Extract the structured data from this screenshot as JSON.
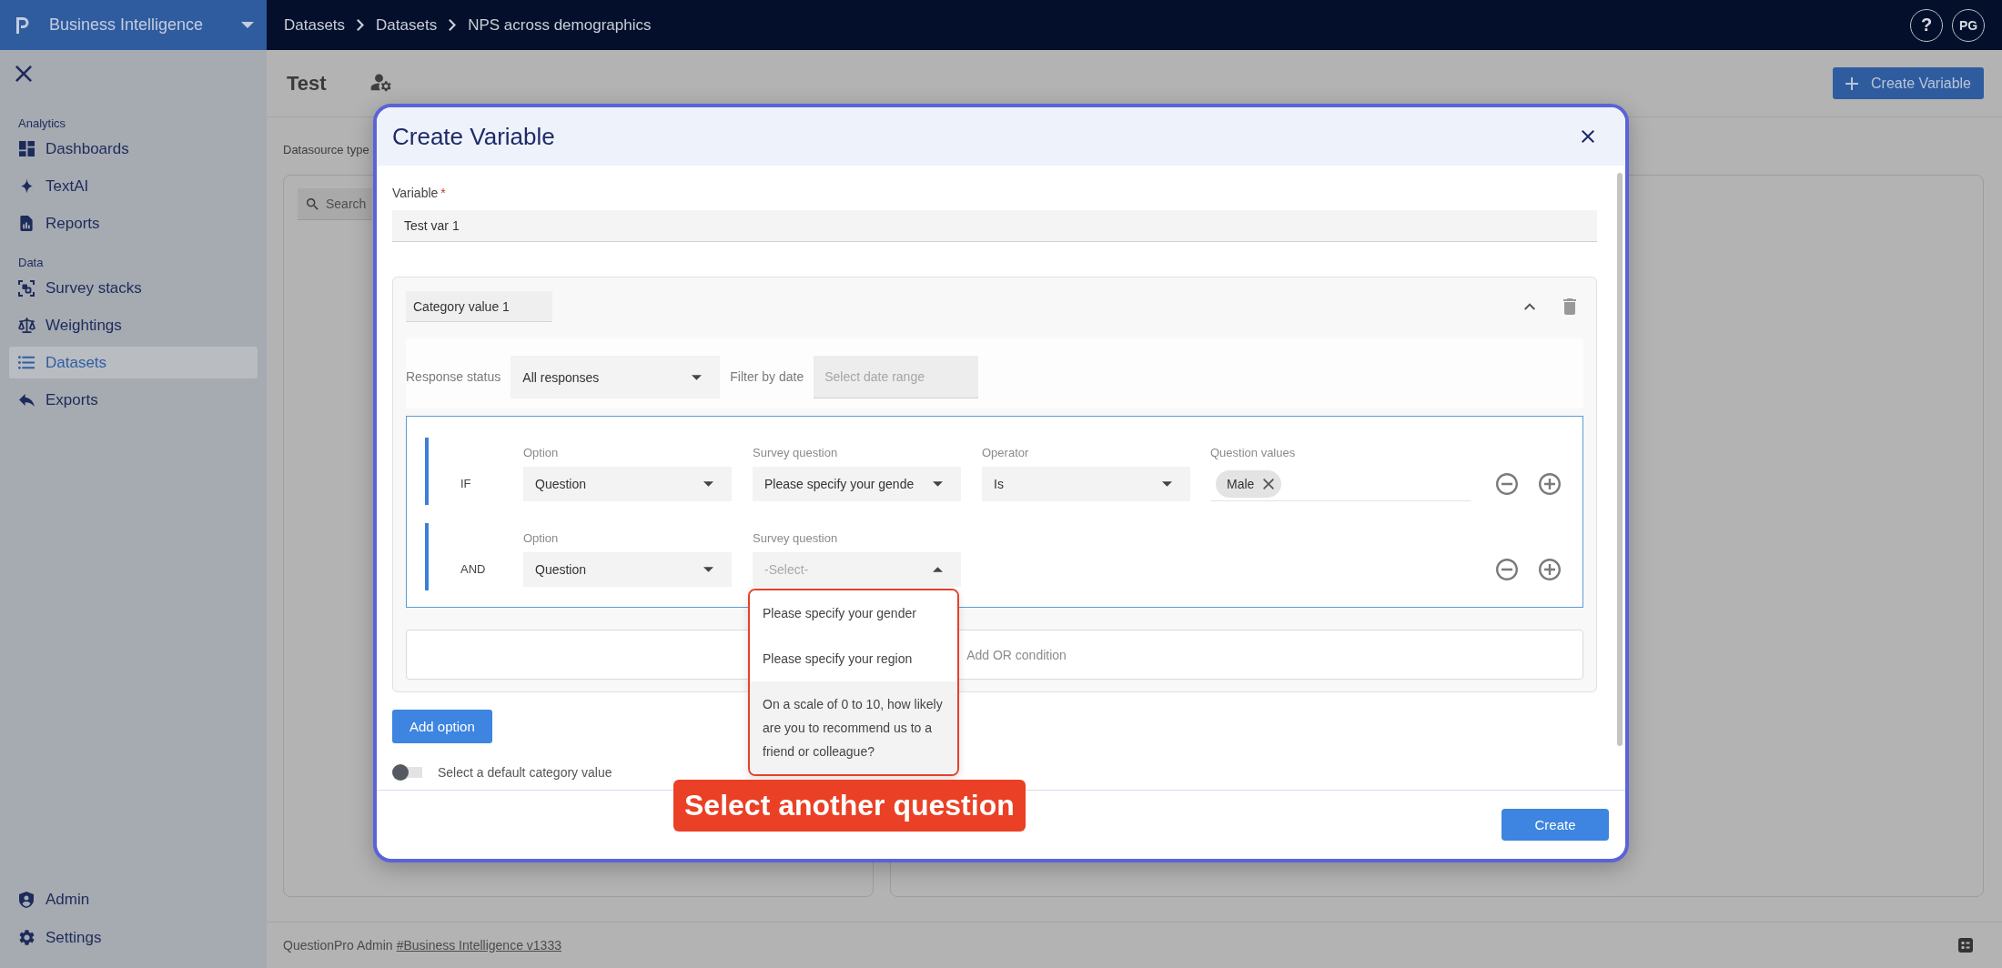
{
  "topbar": {
    "app_name": "Business Intelligence",
    "breadcrumbs": [
      {
        "label": "Datasets"
      },
      {
        "label": "Datasets"
      },
      {
        "label": "NPS across demographics"
      }
    ],
    "help_label": "?",
    "avatar_initials": "PG"
  },
  "sidebar": {
    "sections": [
      {
        "title": "Analytics",
        "items": [
          {
            "label": "Dashboards",
            "selected": false
          },
          {
            "label": "TextAI",
            "selected": false
          },
          {
            "label": "Reports",
            "selected": false
          }
        ]
      },
      {
        "title": "Data",
        "items": [
          {
            "label": "Survey stacks",
            "selected": false
          },
          {
            "label": "Weightings",
            "selected": false
          },
          {
            "label": "Datasets",
            "selected": true
          },
          {
            "label": "Exports",
            "selected": false
          }
        ]
      }
    ],
    "bottom_items": [
      {
        "label": "Admin",
        "selected": false
      },
      {
        "label": "Settings",
        "selected": false
      }
    ]
  },
  "page": {
    "title": "Test",
    "create_button": "Create Variable",
    "datasource_label": "Datasource type",
    "search_placeholder": "Search"
  },
  "modal": {
    "title": "Create Variable",
    "variable": {
      "label": "Variable",
      "required_mark": "*",
      "value": "Test var 1"
    },
    "category": {
      "name": "Category value 1",
      "expanded": true,
      "filters": [
        {
          "kind": "select",
          "label": "Response status",
          "value": "All responses",
          "open": false
        },
        {
          "kind": "date",
          "label": "Filter by date",
          "placeholder": "Select date range"
        }
      ],
      "conditions": [
        {
          "connector": "IF",
          "fields": [
            {
              "kind": "select",
              "label": "Option",
              "value": "Question",
              "open": false
            },
            {
              "kind": "select",
              "label": "Survey question",
              "value": "Please specify your gende",
              "open": false
            },
            {
              "kind": "select",
              "label": "Operator",
              "value": "Is",
              "open": false
            },
            {
              "kind": "tags",
              "label": "Question values",
              "chips": [
                "Male"
              ]
            }
          ]
        },
        {
          "connector": "AND",
          "fields": [
            {
              "kind": "select",
              "label": "Option",
              "value": "Question",
              "open": false
            },
            {
              "kind": "select",
              "label": "Survey question",
              "placeholder": "-Select-",
              "open": true,
              "options": [
                {
                  "label": "Please specify your gender",
                  "highlighted": false
                },
                {
                  "label": "Please specify your region",
                  "highlighted": false
                },
                {
                  "label": "On a scale of 0 to 10, how likely are you to recommend us to a friend or colleague?",
                  "highlighted": true
                }
              ]
            }
          ]
        }
      ],
      "add_or_label": "Add OR condition"
    },
    "add_option": "Add option",
    "default_toggle": {
      "label": "Select a default category value",
      "on": false
    },
    "create_button": "Create"
  },
  "callout": {
    "text": "Select another question"
  },
  "footer": {
    "text": "QuestionPro Admin",
    "link": "#Business Intelligence v1333"
  }
}
